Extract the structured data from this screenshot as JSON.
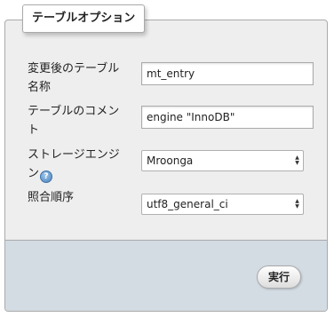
{
  "legend": "テーブルオプション",
  "fields": {
    "rename": {
      "label": "変更後のテーブル名称",
      "value": "mt_entry"
    },
    "comment": {
      "label": "テーブルのコメント",
      "value": "engine \"InnoDB\""
    },
    "engine": {
      "label": "ストレージエンジン",
      "value": "Mroonga",
      "help_icon": "question-mark-icon"
    },
    "collation": {
      "label": "照合順序",
      "value": "utf8_general_ci"
    }
  },
  "actions": {
    "submit_label": "実行"
  }
}
